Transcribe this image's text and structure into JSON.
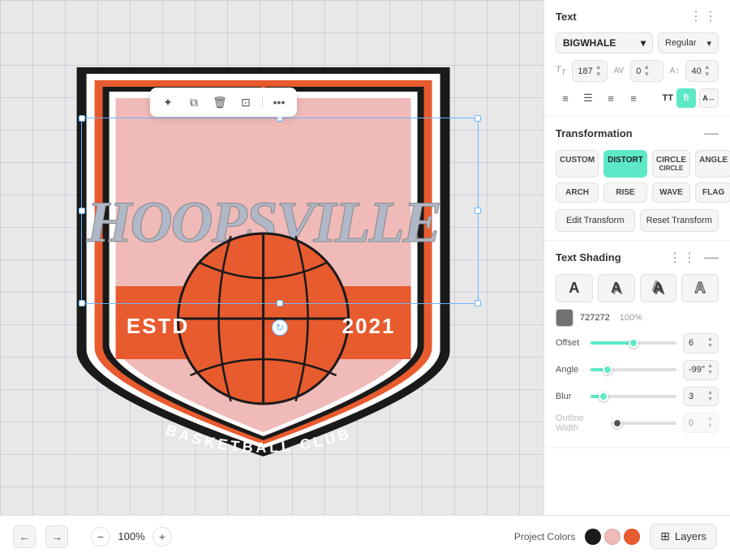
{
  "panel": {
    "title": "Text",
    "dots": "⋮⋮",
    "font": {
      "family": "BIGWHALE",
      "style": "Regular",
      "size": "187",
      "tracking": "0",
      "leading": "40"
    },
    "align": {
      "buttons": [
        "≡",
        "☰",
        "≡",
        "≡"
      ],
      "tt_label": "TT",
      "special1_label": "fi",
      "special2_label": "A↔"
    },
    "transformation": {
      "title": "Transformation",
      "buttons": [
        {
          "label": "CUSTOM",
          "active": false
        },
        {
          "label": "DISTORT",
          "active": true
        },
        {
          "label": "CIRCLE",
          "sub": "CIRCLE",
          "active": false
        },
        {
          "label": "ANGLE",
          "active": false
        },
        {
          "label": "ARCH",
          "active": false
        },
        {
          "label": "RISE",
          "active": false
        },
        {
          "label": "WAVE",
          "active": false
        },
        {
          "label": "FLAG",
          "active": false
        }
      ],
      "edit_btn": "Edit Transform",
      "reset_btn": "Reset Transform"
    },
    "text_shading": {
      "title": "Text Shading",
      "dots": "⋮⋮",
      "collapse": "—",
      "shades": [
        "A",
        "A",
        "A",
        "A"
      ],
      "color_hex": "727272",
      "color_opacity": "100%",
      "offset_label": "Offset",
      "offset_value": "6",
      "angle_label": "Angle",
      "angle_value": "-99°",
      "blur_label": "Blur",
      "blur_value": "3",
      "outline_label": "Outline Width",
      "outline_value": "0"
    }
  },
  "bottom_bar": {
    "zoom_level": "100%",
    "project_colors_label": "Project Colors",
    "colors": [
      "#E85B2E",
      "#1a1a1a",
      "#EFBAB8",
      "#E8E0D0"
    ],
    "layers_label": "Layers",
    "layers_icon": "⊞"
  },
  "canvas": {
    "toolbar_buttons": [
      "✦",
      "⧉",
      "🗑",
      "⊡",
      "•••"
    ]
  }
}
